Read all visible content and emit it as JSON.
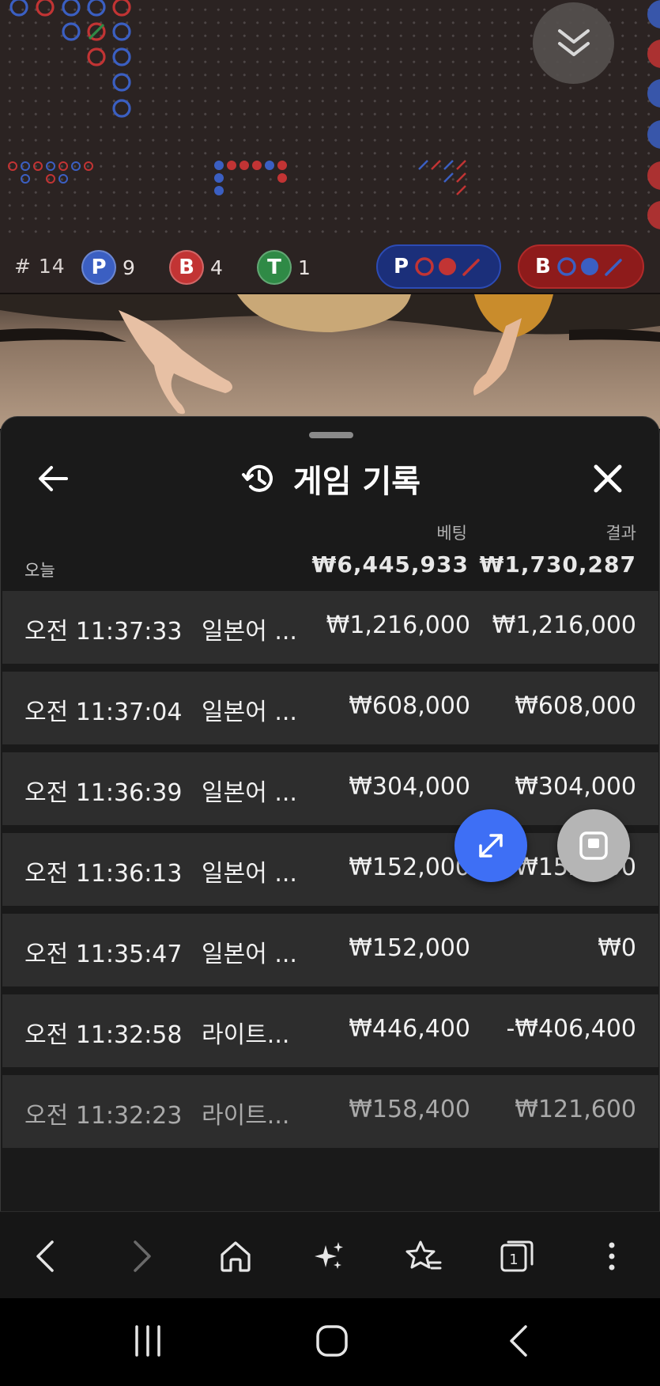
{
  "scoreboard": {
    "hand_count": "# 14",
    "player": {
      "letter": "P",
      "count": "9",
      "color": "#3b5fc2"
    },
    "banker": {
      "letter": "B",
      "count": "4",
      "color": "#c23434"
    },
    "tie": {
      "letter": "T",
      "count": "1",
      "color": "#2f8a46"
    },
    "player_predict": {
      "letter": "P"
    },
    "banker_predict": {
      "letter": "B"
    }
  },
  "sheet": {
    "title": "게임 기록",
    "columns": {
      "bet": "베팅",
      "result": "결과"
    },
    "today_label": "오늘",
    "totals": {
      "bet": "₩6,445,933",
      "result": "₩1,730,287"
    },
    "rows": [
      {
        "time": "오전 11:37:33",
        "game": "일본어 ...",
        "bet": "₩1,216,000",
        "result": "₩1,216,000"
      },
      {
        "time": "오전 11:37:04",
        "game": "일본어 ...",
        "bet": "₩608,000",
        "result": "₩608,000"
      },
      {
        "time": "오전 11:36:39",
        "game": "일본어 ...",
        "bet": "₩304,000",
        "result": "₩304,000"
      },
      {
        "time": "오전 11:36:13",
        "game": "일본어 ...",
        "bet": "₩152,000",
        "result": "₩152,000"
      },
      {
        "time": "오전 11:35:47",
        "game": "일본어 ...",
        "bet": "₩152,000",
        "result": "₩0"
      },
      {
        "time": "오전 11:32:58",
        "game": "라이트...",
        "bet": "₩446,400",
        "result": "-₩406,400"
      },
      {
        "time": "오전 11:32:23",
        "game": "라이트...",
        "bet": "₩158,400",
        "result": "₩121,600"
      }
    ]
  },
  "icons": {
    "back": "arrow-left-icon",
    "history": "history-icon",
    "close": "close-icon",
    "expand": "expand-diagonal-icon",
    "stop": "stop-square-icon",
    "collapse": "double-chevron-down-icon"
  },
  "browser_toolbar": [
    "back-icon",
    "forward-icon",
    "home-icon",
    "sparkle-icon",
    "bookmark-star-icon",
    "tabs-icon",
    "more-menu-icon"
  ],
  "browser_tab_count": "1",
  "colors": {
    "player_blue": "#3b5fc2",
    "banker_red": "#c23434",
    "tie_green": "#2f8a46",
    "fab_blue": "#3e6ff5"
  }
}
